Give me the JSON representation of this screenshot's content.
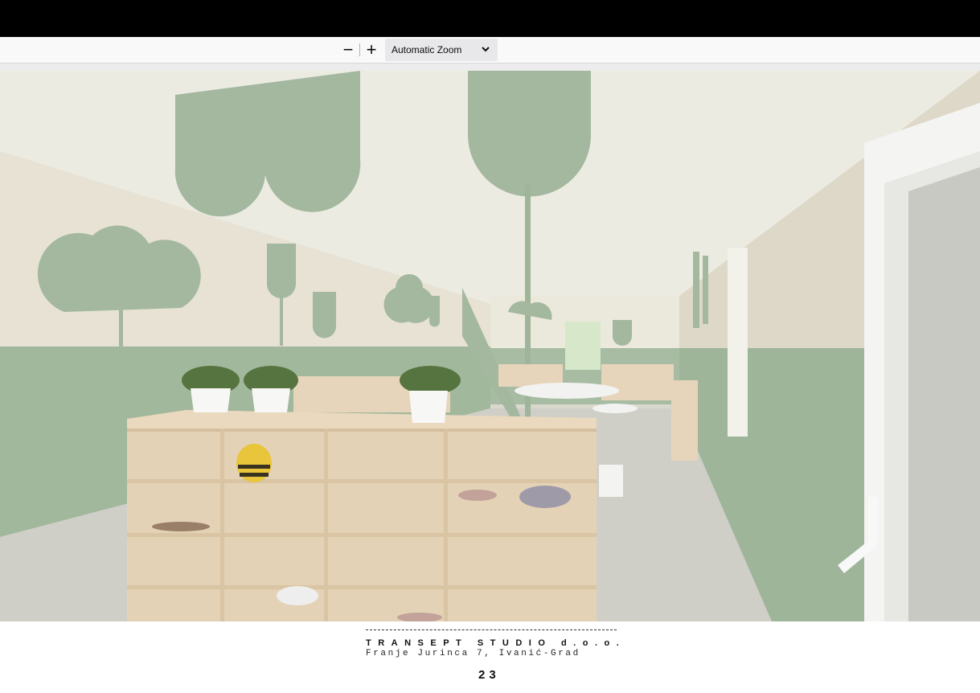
{
  "toolbar": {
    "zoom_out_icon": "minus-icon",
    "zoom_in_icon": "plus-icon",
    "zoom_out_glyph": "−",
    "zoom_in_glyph": "+",
    "zoom_select_value": "Automatic Zoom",
    "zoom_select_icon": "chevron-down-icon",
    "zoom_select_glyph": "⌄"
  },
  "document": {
    "footer_company": "TRANSEPT STUDIO d.o.o.",
    "footer_address": "Franje Jurinca 7, Ivanić-Grad",
    "page_number": "23"
  },
  "colors": {
    "top_bar": "#000000",
    "toolbar_bg": "#f9f9fa",
    "wall_green": "#9fb59a",
    "wall_cream": "#e5e0d2",
    "ceiling": "#ecebe2",
    "wood": "#e2cfb2"
  }
}
